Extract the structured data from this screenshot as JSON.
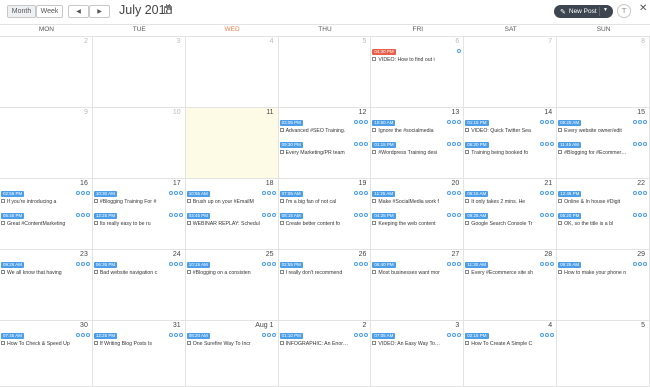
{
  "toolbar": {
    "view_month": "Month",
    "view_week": "Week",
    "prev_label": "◀",
    "next_label": "▶",
    "title": "July 2018",
    "new_post": "New Post",
    "filter_icon": "filter-icon",
    "close_icon": "close-icon"
  },
  "weekdays": [
    "MON",
    "TUE",
    "WED",
    "THU",
    "FRI",
    "SAT",
    "SUN"
  ],
  "today_index": 2,
  "weeks": [
    {
      "days": [
        {
          "num": "2",
          "dim": true,
          "posts": []
        },
        {
          "num": "3",
          "dim": true,
          "posts": []
        },
        {
          "num": "4",
          "dim": true,
          "posts": []
        },
        {
          "num": "5",
          "dim": true,
          "posts": []
        },
        {
          "num": "6",
          "dim": true,
          "posts": [
            {
              "time": "04:30 PM",
              "red": true,
              "text": "VIDEO: How to find out i"
            }
          ]
        },
        {
          "num": "7",
          "dim": true,
          "posts": []
        },
        {
          "num": "8",
          "dim": true,
          "posts": []
        }
      ]
    },
    {
      "days": [
        {
          "num": "9",
          "dim": true,
          "posts": []
        },
        {
          "num": "10",
          "dim": true,
          "posts": []
        },
        {
          "num": "11",
          "dim": false,
          "today": true,
          "posts": []
        },
        {
          "num": "12",
          "dim": false,
          "posts": [
            {
              "time": "03:05 PM",
              "text": "Advanced #SEO Training."
            },
            {
              "time": "09:30 PM",
              "text": "Every Marketing/PR team"
            }
          ]
        },
        {
          "num": "13",
          "dim": false,
          "posts": [
            {
              "time": "10:50 AM",
              "text": "Ignore the #socialmedia"
            },
            {
              "time": "01:15 PM",
              "text": "#Wordpress Training desi"
            }
          ]
        },
        {
          "num": "14",
          "dim": false,
          "posts": [
            {
              "time": "01:15 PM",
              "text": "VIDEO: Quick Twitter Sea"
            },
            {
              "time": "05:20 PM",
              "text": "Training being booked fo"
            }
          ]
        },
        {
          "num": "15",
          "dim": false,
          "posts": [
            {
              "time": "09:25 AM",
              "text": "Every website owner/edit"
            },
            {
              "time": "11:45 AM",
              "text": "#Blogging for #Ecommer…"
            }
          ]
        }
      ]
    },
    {
      "days": [
        {
          "num": "16",
          "dim": false,
          "posts": [
            {
              "time": "02:55 PM",
              "text": "If you're introducing a"
            },
            {
              "time": "05:45 PM",
              "text": "Great #ContentMarketing"
            }
          ]
        },
        {
          "num": "17",
          "dim": false,
          "posts": [
            {
              "time": "10:30 AM",
              "text": "#Blogging Training For #"
            },
            {
              "time": "12:25 PM",
              "text": "Its really easy to be ru"
            }
          ]
        },
        {
          "num": "18",
          "dim": false,
          "posts": [
            {
              "time": "10:55 AM",
              "text": "Brush up on your #EmailM"
            },
            {
              "time": "03:45 PM",
              "text": "WEBINAR REPLAY: Schedul"
            }
          ]
        },
        {
          "num": "19",
          "dim": false,
          "posts": [
            {
              "time": "07:05 AM",
              "text": "I'm a big fan of not cal"
            },
            {
              "time": "08:15 AM",
              "text": "Create better content fo"
            }
          ]
        },
        {
          "num": "20",
          "dim": false,
          "posts": [
            {
              "time": "11:25 AM",
              "text": "Make #SocialMedia work f"
            },
            {
              "time": "04:25 PM",
              "text": "Keeping the web content"
            }
          ]
        },
        {
          "num": "21",
          "dim": false,
          "posts": [
            {
              "time": "06:15 AM",
              "text": "It only takes 2 mins. He"
            },
            {
              "time": "09:25 AM",
              "text": "Google Search Console Tr"
            }
          ]
        },
        {
          "num": "22",
          "dim": false,
          "posts": [
            {
              "time": "12:45 PM",
              "text": "Online & In house #Digit"
            },
            {
              "time": "05:20 PM",
              "text": "OK, so the title is a bl"
            }
          ]
        }
      ]
    },
    {
      "days": [
        {
          "num": "23",
          "dim": false,
          "posts": [
            {
              "time": "09:25 AM",
              "text": "We all know that having"
            }
          ]
        },
        {
          "num": "24",
          "dim": false,
          "posts": [
            {
              "time": "06:35 PM",
              "text": "Bad website navigation c"
            }
          ]
        },
        {
          "num": "25",
          "dim": false,
          "posts": [
            {
              "time": "10:15 AM",
              "text": "#Blogging on a consisten"
            }
          ]
        },
        {
          "num": "26",
          "dim": false,
          "posts": [
            {
              "time": "02:55 PM",
              "text": "I really don't recommend"
            }
          ]
        },
        {
          "num": "27",
          "dim": false,
          "posts": [
            {
              "time": "06:40 PM",
              "text": "Most businesses want mor"
            }
          ]
        },
        {
          "num": "28",
          "dim": false,
          "posts": [
            {
              "time": "11:30 AM",
              "text": "Every #Ecommerce site sh"
            }
          ]
        },
        {
          "num": "29",
          "dim": false,
          "posts": [
            {
              "time": "09:25 AM",
              "text": "How to make your phone n"
            }
          ]
        }
      ]
    },
    {
      "days": [
        {
          "num": "30",
          "dim": false,
          "posts": [
            {
              "time": "07:45 AM",
              "text": "How To Check & Speed Up"
            }
          ]
        },
        {
          "num": "31",
          "dim": false,
          "posts": [
            {
              "time": "12:25 PM",
              "text": "If Writing Blog Posts Is"
            }
          ]
        },
        {
          "num": "Aug 1",
          "dim": false,
          "posts": [
            {
              "time": "08:20 AM",
              "text": "One Surefire Way To Incr"
            }
          ]
        },
        {
          "num": "2",
          "dim": false,
          "posts": [
            {
              "time": "01:10 PM",
              "text": "INFOGRAPHIC: An Enor…"
            }
          ]
        },
        {
          "num": "3",
          "dim": false,
          "posts": [
            {
              "time": "07:05 AM",
              "text": "VIDEO: An Easy Way To…"
            }
          ]
        },
        {
          "num": "4",
          "dim": false,
          "posts": [
            {
              "time": "02:15 PM",
              "text": "How To Create A Simple C"
            }
          ]
        },
        {
          "num": "5",
          "dim": false,
          "posts": []
        }
      ]
    }
  ]
}
